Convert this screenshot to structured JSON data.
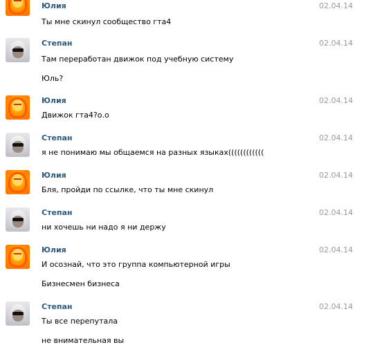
{
  "messages": [
    {
      "author": "Юлия",
      "avatar": "julia-avatar",
      "date": "02.04.14",
      "lines": [
        "Ты мне скинул сообщество гта4"
      ]
    },
    {
      "author": "Степан",
      "avatar": "stepan-avatar",
      "date": "02.04.14",
      "lines": [
        "Там переработан движок под учебную систему",
        "Юль?"
      ]
    },
    {
      "author": "Юлия",
      "avatar": "julia-avatar",
      "date": "02.04.14",
      "lines": [
        "Движок гта4?о.о"
      ]
    },
    {
      "author": "Степан",
      "avatar": "stepan-avatar",
      "date": "02.04.14",
      "lines": [
        "я не понимаю мы общаемся на разных языках(((((((((((("
      ]
    },
    {
      "author": "Юлия",
      "avatar": "julia-avatar",
      "date": "02.04.14",
      "lines": [
        "Бля, пройди по ссылке, что ты мне скинул"
      ]
    },
    {
      "author": "Степан",
      "avatar": "stepan-avatar",
      "date": "02.04.14",
      "lines": [
        "ни хочешь ни надо я ни держу"
      ]
    },
    {
      "author": "Юлия",
      "avatar": "julia-avatar",
      "date": "02.04.14",
      "lines": [
        "И осознай, что это группа компьютерной игры",
        "Бизнесмен бизнеса"
      ]
    },
    {
      "author": "Степан",
      "avatar": "stepan-avatar",
      "date": "02.04.14",
      "lines": [
        "Ты все перепутала",
        "не внимательная вы"
      ]
    }
  ],
  "colors": {
    "author": "#2b587a",
    "date": "#999999",
    "text": "#000000"
  }
}
